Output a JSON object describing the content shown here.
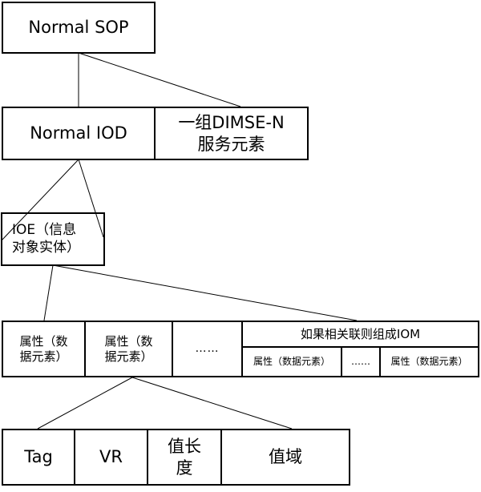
{
  "normal_sop": "Normal SOP",
  "normal_iod": "Normal IOD",
  "dimse_n_line1": "一组DIMSE-N",
  "dimse_n_line2": "服务元素",
  "ioe_line1": "IOE（信息",
  "ioe_line2": "对象实体）",
  "attribute_line1": "属性（数",
  "attribute_line2": "据元素）",
  "ellipsis": "……",
  "iom_header": "如果相关联则组成IOM",
  "iom_attribute": "属性（数据元素）",
  "iom_ellipsis": "……",
  "tag": "Tag",
  "vr": "VR",
  "value_length_line1": "值长",
  "value_length_line2": "度",
  "value_field": "值域"
}
